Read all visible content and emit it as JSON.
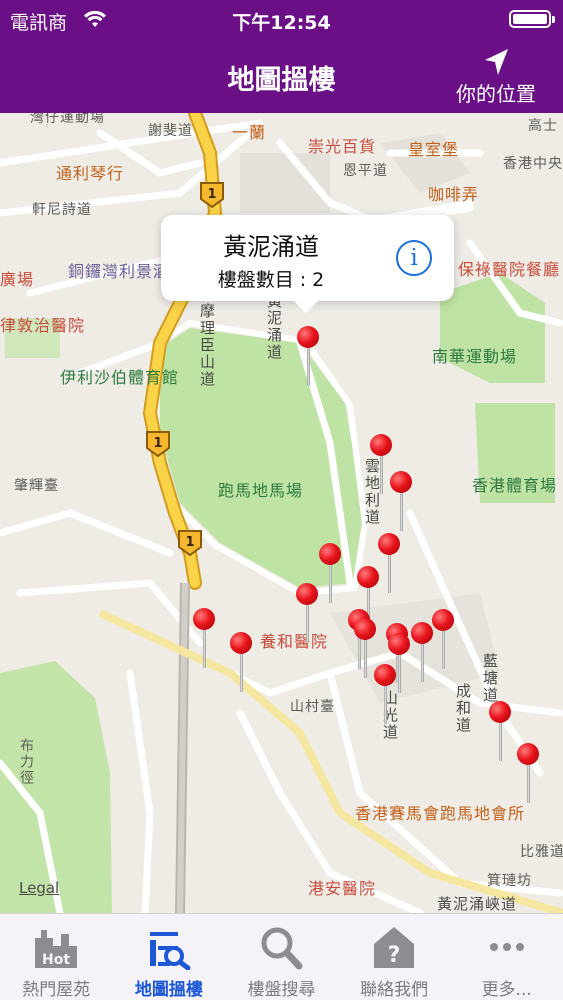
{
  "status": {
    "carrier": "電訊商",
    "time": "下午12:54"
  },
  "nav": {
    "title": "地圖搵樓",
    "location_button": "你的位置"
  },
  "callout": {
    "title": "黃泥涌道",
    "subtitle": "樓盤數目 : 2"
  },
  "map": {
    "legal": "Legal",
    "labels": {
      "sports_ground_top": "灣仔運動場",
      "tse_stg": "謝斐道",
      "yat_lan": "一蘭",
      "sung_kwong": "崇光百貨",
      "hk_central": "香港中央",
      "tung_lei": "通利琴行",
      "hysan": "恩平道",
      "royal_castle": "皇室堡",
      "coffee": "咖啡弄",
      "hennessy": "軒尼詩道",
      "causeway_hotel": "銅鑼灣利景酒店",
      "po_leung": "保祿醫院餐廳",
      "plaza": "廣場",
      "ruttonjee": "律敦治醫院",
      "wong_nai_chung_rd": "黃泥涌道",
      "morrison": "摩理臣山道",
      "south_china": "南華運動場",
      "queen_elizabeth": "伊利沙伯體育館",
      "racecourse": "跑馬地馬場",
      "hk_stadium": "香港體育場",
      "yuk_sau": "雲地利道",
      "village_terrace": "肇輝臺",
      "yeung_wo": "養和醫院",
      "shan_kwong": "山光道",
      "lam_street": "藍塘道",
      "sing_woo": "成和道",
      "village_terr2": "山村臺",
      "po_shan": "布力徑",
      "jockey_club": "香港賽馬會跑馬地會所",
      "bisney": "比雅道",
      "canossa": "港安醫院",
      "king_kwong": "箕璉坊",
      "wong_nai_chung_gap": "黃泥涌峽道",
      "ko_shing": "高士"
    },
    "route_number": "1"
  },
  "tabs": [
    {
      "label": "熱門屋苑",
      "icon": "hot-buildings-icon"
    },
    {
      "label": "地圖搵樓",
      "icon": "map-search-icon"
    },
    {
      "label": "樓盤搜尋",
      "icon": "magnifier-icon"
    },
    {
      "label": "聯絡我們",
      "icon": "help-house-icon"
    },
    {
      "label": "更多...",
      "icon": "more-icon"
    }
  ],
  "colors": {
    "nav": "#6b0f86",
    "active_tab": "#1c57d6",
    "pin": "#e8141c",
    "park": "#bfe3a5"
  }
}
